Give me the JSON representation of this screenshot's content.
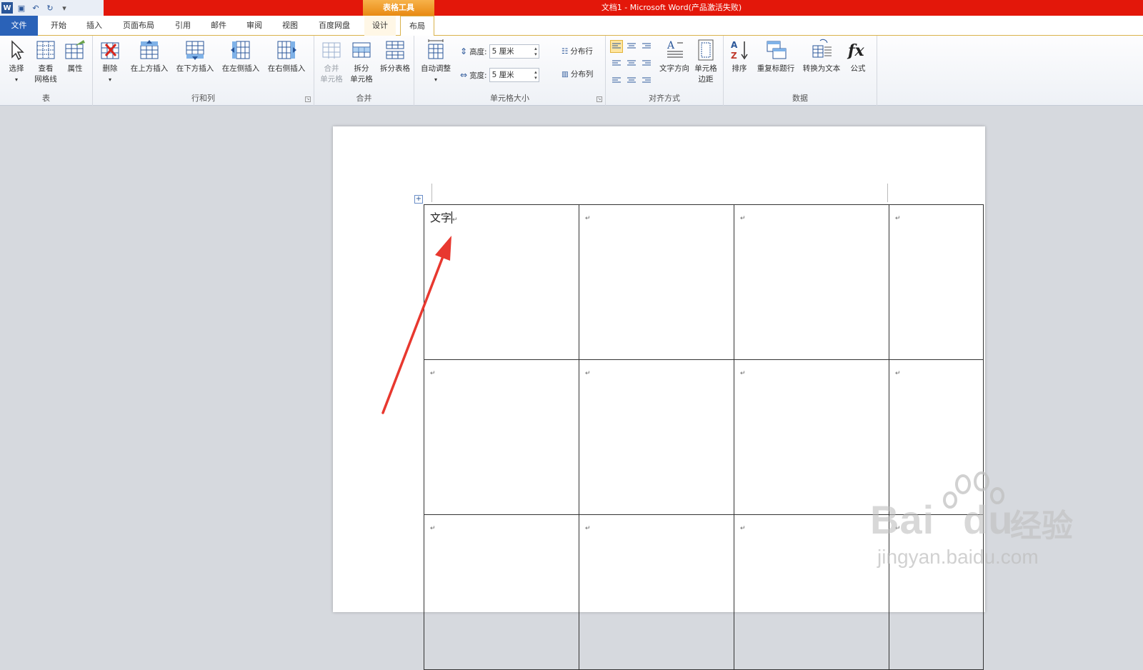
{
  "titlebar": {
    "context_tab_group": "表格工具",
    "window_title": "文档1 - Microsoft Word(产品激活失败)"
  },
  "tabs": [
    "文件",
    "开始",
    "插入",
    "页面布局",
    "引用",
    "邮件",
    "审阅",
    "视图",
    "百度网盘",
    "设计",
    "布局"
  ],
  "active_tab": "布局",
  "ribbon": {
    "table_group": {
      "label": "表",
      "select": "选择",
      "gridlines_line1": "查看",
      "gridlines_line2": "网格线",
      "properties": "属性"
    },
    "rows_cols_group": {
      "label": "行和列",
      "delete": "删除",
      "insert_above": "在上方插入",
      "insert_below": "在下方插入",
      "insert_left": "在左侧插入",
      "insert_right": "在右侧插入"
    },
    "merge_group": {
      "label": "合并",
      "merge_line1": "合并",
      "merge_line2": "单元格",
      "split_line1": "拆分",
      "split_line2": "单元格",
      "split_table": "拆分表格"
    },
    "cell_size_group": {
      "label": "单元格大小",
      "autofit": "自动调整",
      "height_label": "高度:",
      "height_value": "5 厘米",
      "width_label": "宽度:",
      "width_value": "5 厘米",
      "distribute_rows": "分布行",
      "distribute_cols": "分布列"
    },
    "alignment_group": {
      "label": "对齐方式",
      "text_direction": "文字方向",
      "cell_margins_line1": "单元格",
      "cell_margins_line2": "边距"
    },
    "data_group": {
      "label": "数据",
      "sort": "排序",
      "repeat_header": "重复标题行",
      "convert_to_text": "转换为文本",
      "formula": "公式"
    }
  },
  "document": {
    "first_cell_text": "文字",
    "paragraph_mark": "↵"
  },
  "watermark": {
    "brand": "Bai",
    "brand2": "du",
    "cn": "经验",
    "url": "jingyan.baidu.com"
  },
  "colors": {
    "title_red": "#e3170a",
    "table_tools_orange": "#f0a030",
    "file_tab_blue": "#2a62b8",
    "annotation_arrow": "#e8382f"
  }
}
